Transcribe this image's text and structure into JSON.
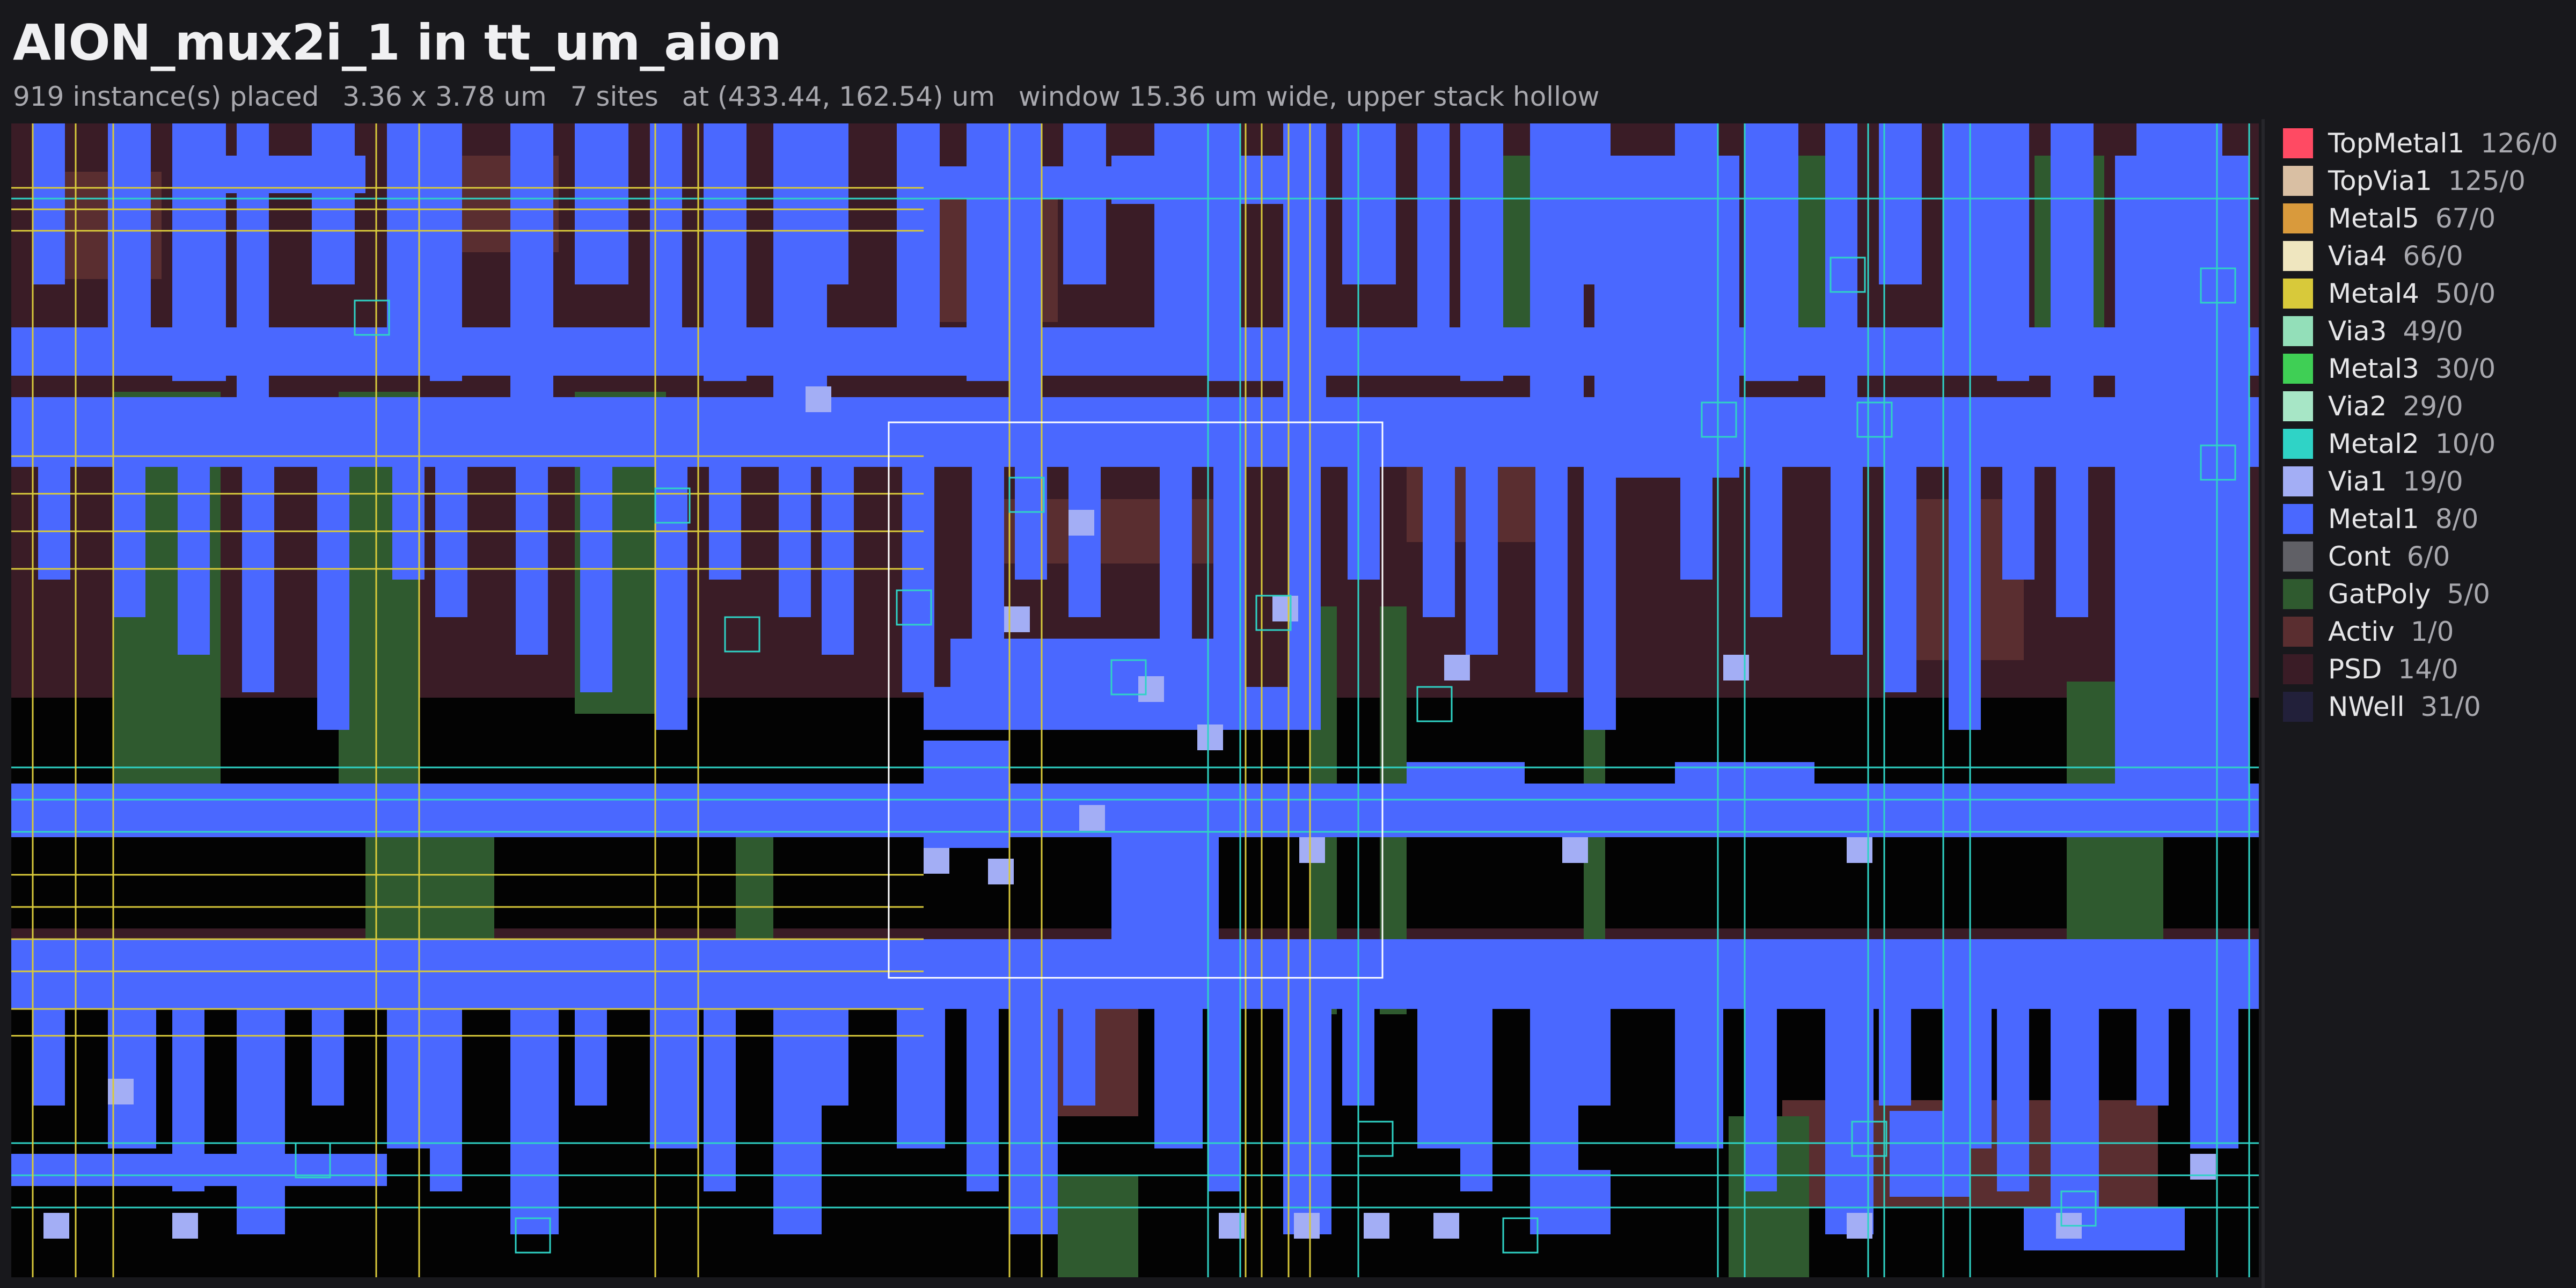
{
  "header": {
    "title": "AION_mux2i_1 in tt_um_aion",
    "instances": "919 instance(s) placed",
    "size": "3.36 x 3.78 um",
    "sites": "7 sites",
    "location": "at (433.44, 162.54) um",
    "window": "window 15.36 um wide, upper stack hollow"
  },
  "legend": [
    {
      "name": "TopMetal1",
      "count": "126/0",
      "color": "#ff4a63"
    },
    {
      "name": "TopVia1",
      "count": "125/0",
      "color": "#d9bfa3"
    },
    {
      "name": "Metal5",
      "count": "67/0",
      "color": "#d99a3c"
    },
    {
      "name": "Via4",
      "count": "66/0",
      "color": "#efe6bf"
    },
    {
      "name": "Metal4",
      "count": "50/0",
      "color": "#d8c93a"
    },
    {
      "name": "Via3",
      "count": "49/0",
      "color": "#93dfb9"
    },
    {
      "name": "Metal3",
      "count": "30/0",
      "color": "#3fcf55"
    },
    {
      "name": "Via2",
      "count": "29/0",
      "color": "#a7e6c6"
    },
    {
      "name": "Metal2",
      "count": "10/0",
      "color": "#2fd3c6"
    },
    {
      "name": "Via1",
      "count": "19/0",
      "color": "#a3aef5"
    },
    {
      "name": "Metal1",
      "count": "8/0",
      "color": "#4a68ff"
    },
    {
      "name": "Cont",
      "count": "6/0",
      "color": "#606066"
    },
    {
      "name": "GatPoly",
      "count": "5/0",
      "color": "#2f5a2f"
    },
    {
      "name": "Activ",
      "count": "1/0",
      "color": "#5a2e30"
    },
    {
      "name": "PSD",
      "count": "14/0",
      "color": "#3a1c26"
    },
    {
      "name": "NWell",
      "count": "31/0",
      "color": "#22203a"
    }
  ]
}
